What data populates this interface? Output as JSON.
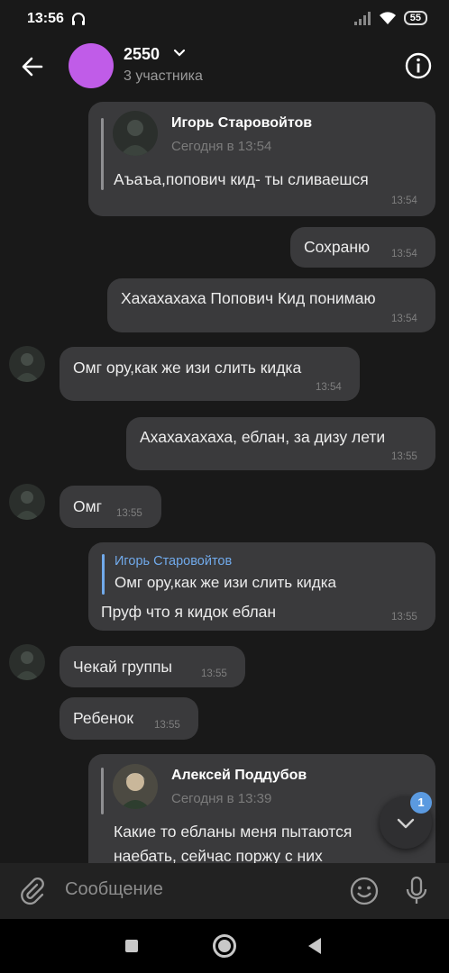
{
  "status_bar": {
    "time": "13:56",
    "battery": "55"
  },
  "header": {
    "title": "2550",
    "subtitle": "3 участника"
  },
  "messages": [
    {
      "reply_name": "Игорь Старовойтов",
      "reply_date": "Сегодня в 13:54",
      "text": "Аъаъа,попович кид- ты сливаешся",
      "time": "13:54"
    },
    {
      "text": "Сохраню",
      "time": "13:54"
    },
    {
      "text": "Хахахахаха Попович Кид понимаю",
      "time": "13:54"
    },
    {
      "text": "Омг ору,как же изи слить кидка",
      "time": "13:54"
    },
    {
      "text": "Ахахахахаха, еблан, за дизу лети",
      "time": "13:55"
    },
    {
      "text": "Омг",
      "time": "13:55"
    },
    {
      "reply_name": "Игорь Старовойтов",
      "reply_text": "Омг ору,как же изи слить кидка",
      "text": "Пруф что я кидок еблан",
      "time": "13:55"
    },
    {
      "text": "Чекай группы",
      "time": "13:55"
    },
    {
      "text": "Ребенок",
      "time": "13:55"
    },
    {
      "reply_name": "Алексей Поддубов",
      "reply_date": "Сегодня в 13:39",
      "text_line1": "Какие то ебланы меня пытаются",
      "text_line2": "наебать, сейчас поржу с них"
    }
  ],
  "scroll_badge": "1",
  "composer": {
    "placeholder": "Сообщение"
  },
  "icons": {
    "back": "arrow-left-icon",
    "info": "info-icon",
    "attach": "paperclip-icon",
    "emoji": "smiley-icon",
    "mic": "microphone-icon",
    "scroll_down": "chevron-down-icon"
  },
  "colors": {
    "background": "#191919",
    "bubble": "#3a3a3c",
    "group_avatar": "#c05ce8",
    "accent": "#71aaeb"
  }
}
